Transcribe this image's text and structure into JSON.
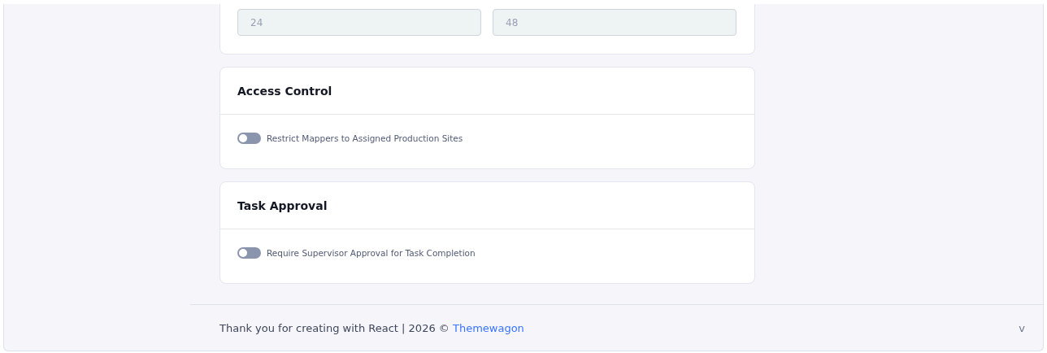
{
  "top_card": {
    "fields": [
      {
        "value": "24"
      },
      {
        "value": "48"
      }
    ]
  },
  "cards": [
    {
      "title": "Access Control",
      "toggles": [
        {
          "label": "Restrict Mappers to Assigned Production Sites",
          "on": false
        }
      ]
    },
    {
      "title": "Task Approval",
      "toggles": [
        {
          "label": "Require Supervisor Approval for Task Completion",
          "on": false
        }
      ]
    }
  ],
  "footer": {
    "text": "Thank you for creating with React | 2026 ©",
    "link": "Themewagon",
    "version": "v"
  }
}
